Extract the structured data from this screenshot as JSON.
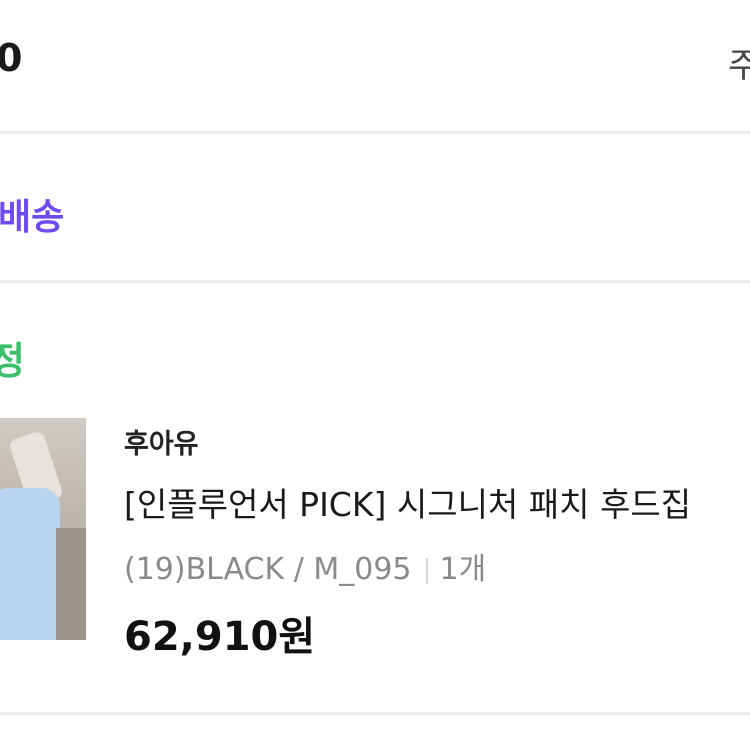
{
  "order": {
    "number_partial": "0",
    "right_link_partial": "주"
  },
  "delivery": {
    "label_partial": "배송"
  },
  "status": {
    "label_partial": "정"
  },
  "item": {
    "brand": "후아유",
    "title": "[인플루언서 PICK] 시그니처 패치 후드집",
    "option": "(19)BLACK / M_095",
    "quantity": "1개",
    "price": "62,910원"
  },
  "colors": {
    "delivery": "#6c4cf0",
    "status": "#3cbf6b",
    "divider": "#ececec"
  }
}
